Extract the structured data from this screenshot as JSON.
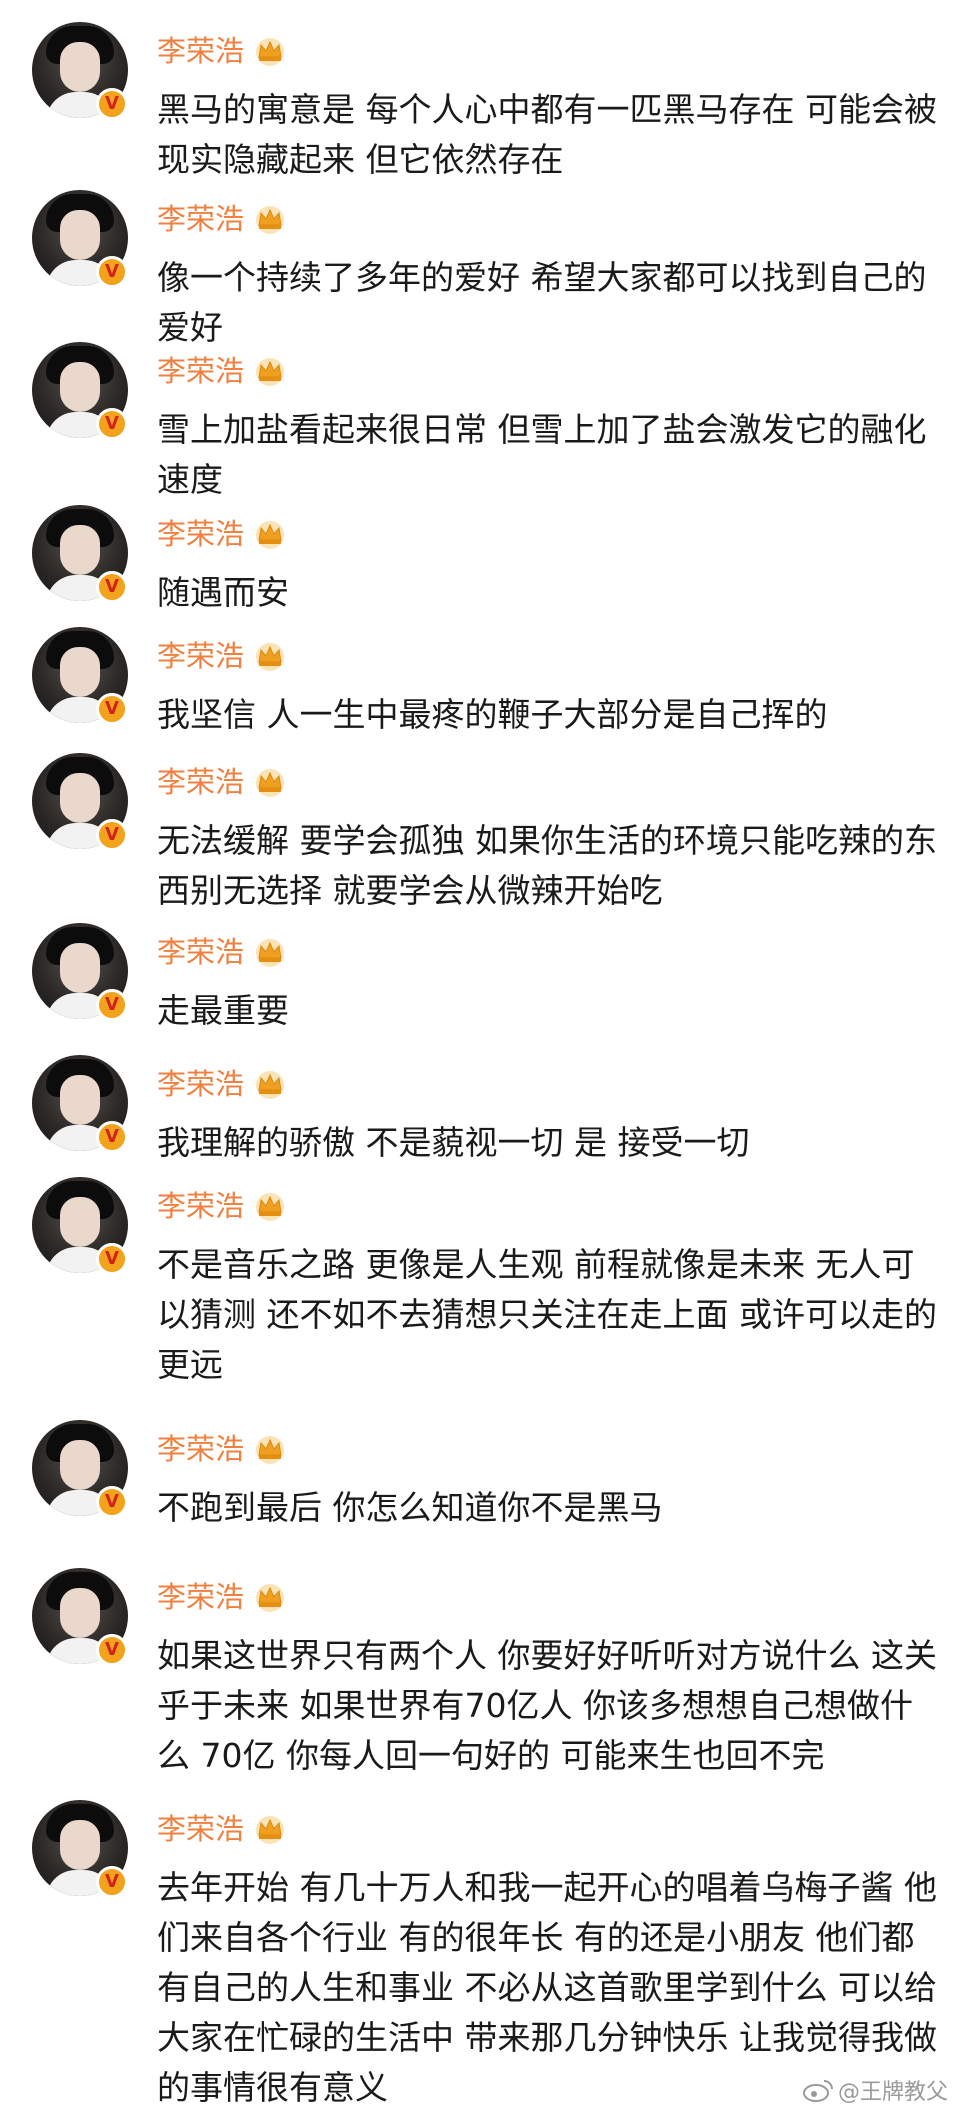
{
  "comments": [
    {
      "user": "李荣浩",
      "text": "黑马的寓意是 每个人心中都有一匹黑马存在 可能会被现实隐藏起来 但它依然存在"
    },
    {
      "user": "李荣浩",
      "text": "像一个持续了多年的爱好 希望大家都可以找到自己的爱好"
    },
    {
      "user": "李荣浩",
      "text": "雪上加盐看起来很日常 但雪上加了盐会激发它的融化速度"
    },
    {
      "user": "李荣浩",
      "text": "随遇而安"
    },
    {
      "user": "李荣浩",
      "text": "我坚信 人一生中最疼的鞭子大部分是自己挥的"
    },
    {
      "user": "李荣浩",
      "text": "无法缓解 要学会孤独 如果你生活的环境只能吃辣的东西别无选择 就要学会从微辣开始吃"
    },
    {
      "user": "李荣浩",
      "text": "走最重要"
    },
    {
      "user": "李荣浩",
      "text": "我理解的骄傲 不是藐视一切 是 接受一切"
    },
    {
      "user": "李荣浩",
      "text": "不是音乐之路 更像是人生观 前程就像是未来 无人可以猜测 还不如不去猜想只关注在走上面 或许可以走的更远"
    },
    {
      "user": "李荣浩",
      "text": "不跑到最后 你怎么知道你不是黑马"
    },
    {
      "user": "李荣浩",
      "text": "如果这世界只有两个人 你要好好听听对方说什么 这关乎于未来 如果世界有70亿人 你该多想想自己想做什么 70亿 你每人回一句好的 可能来生也回不完"
    },
    {
      "user": "李荣浩",
      "text": "去年开始 有几十万人和我一起开心的唱着乌梅子酱 他们来自各个行业 有的很年长 有的还是小朋友 他们都有自己的人生和事业 不必从这首歌里学到什么 可以给大家在忙碌的生活中 带来那几分钟快乐 让我觉得我做的事情很有意义"
    }
  ],
  "watermark": "@王牌教父",
  "colors": {
    "username": "#f08040",
    "text": "#1a1a1a",
    "badge": "#f2a21b",
    "crown": "#f0a020"
  },
  "icons": {
    "avatar": "user-avatar",
    "badge": "verified-v-icon",
    "crown": "crown-icon",
    "watermark": "weibo-icon"
  }
}
